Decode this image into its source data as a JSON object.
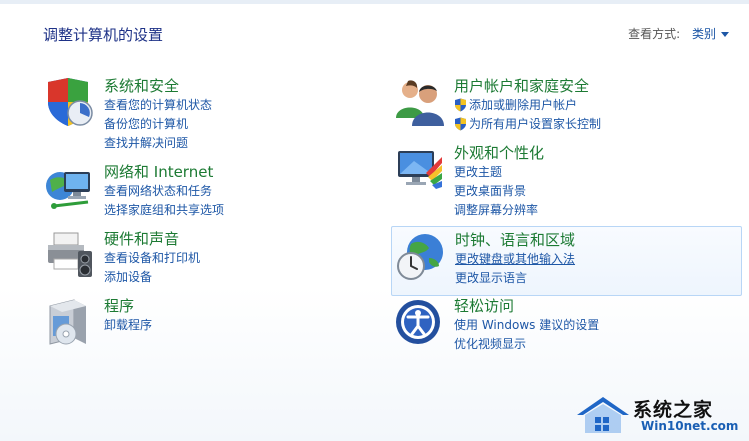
{
  "header": {
    "title": "调整计算机的设置",
    "view_by_label": "查看方式:",
    "view_by_value": "类别"
  },
  "categories": [
    {
      "title": "系统和安全",
      "icon": "system-security-icon",
      "links": [
        "查看您的计算机状态",
        "备份您的计算机",
        "查找并解决问题"
      ]
    },
    {
      "title": "网络和 Internet",
      "icon": "network-icon",
      "links": [
        "查看网络状态和任务",
        "选择家庭组和共享选项"
      ]
    },
    {
      "title": "硬件和声音",
      "icon": "hardware-sound-icon",
      "links": [
        "查看设备和打印机",
        "添加设备"
      ]
    },
    {
      "title": "程序",
      "icon": "programs-icon",
      "links": [
        "卸载程序"
      ]
    },
    {
      "title": "用户帐户和家庭安全",
      "icon": "user-accounts-icon",
      "links": [
        "添加或删除用户帐户",
        "为所有用户设置家长控制"
      ]
    },
    {
      "title": "外观和个性化",
      "icon": "appearance-icon",
      "links": [
        "更改主题",
        "更改桌面背景",
        "调整屏幕分辨率"
      ]
    },
    {
      "title": "时钟、语言和区域",
      "icon": "clock-language-icon",
      "links": [
        "更改键盘或其他输入法",
        "更改显示语言"
      ]
    },
    {
      "title": "轻松访问",
      "icon": "ease-of-access-icon",
      "links": [
        "使用 Windows 建议的设置",
        "优化视频显示"
      ]
    }
  ],
  "watermark": {
    "brand": "系统之家",
    "site": "Win10net.com"
  },
  "colors": {
    "category_title": "#1c7a33",
    "link": "#1e57a6",
    "page_title": "#1e3287",
    "highlight_border": "#b8d6f6"
  }
}
